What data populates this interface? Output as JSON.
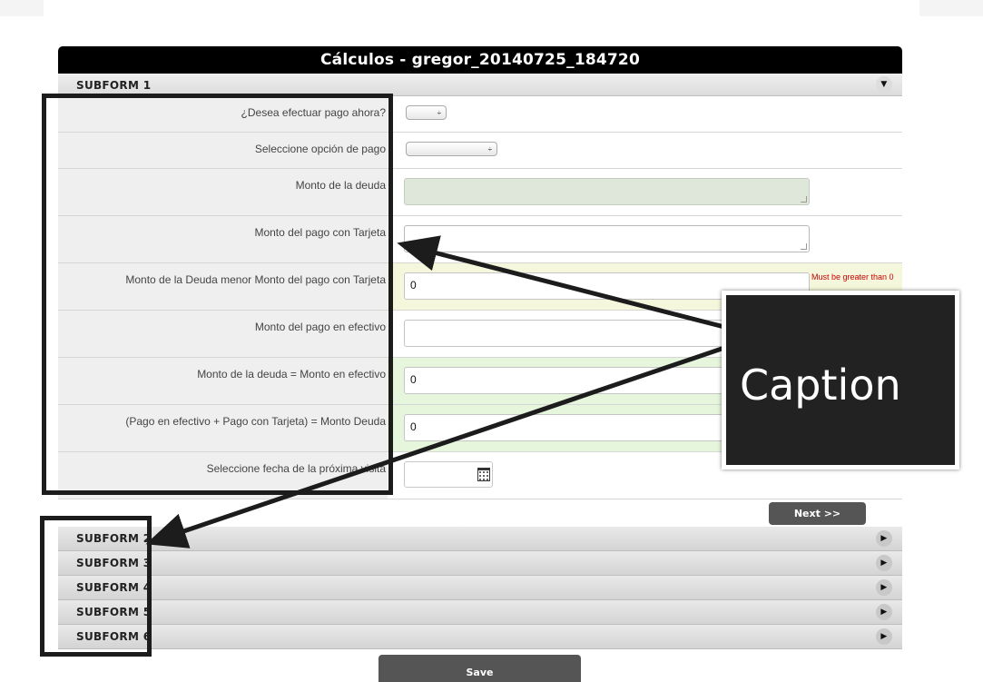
{
  "window": {
    "title": "Cálculos - gregor_20140725_184720"
  },
  "subforms": {
    "active": {
      "label": "SUBFORM 1",
      "toggle_icon": "chevron-down-icon",
      "toggle_glyph": "▼"
    },
    "collapsed": [
      {
        "label": "SUBFORM 2",
        "toggle_icon": "play-icon",
        "toggle_glyph": "▶"
      },
      {
        "label": "SUBFORM 3",
        "toggle_icon": "play-icon",
        "toggle_glyph": "▶"
      },
      {
        "label": "SUBFORM 4",
        "toggle_icon": "play-icon",
        "toggle_glyph": "▶"
      },
      {
        "label": "SUBFORM 5",
        "toggle_icon": "play-icon",
        "toggle_glyph": "▶"
      },
      {
        "label": "SUBFORM 6",
        "toggle_icon": "play-icon",
        "toggle_glyph": "▶"
      }
    ]
  },
  "form": {
    "fields": [
      {
        "label": "¿Desea efectuar pago ahora?",
        "type": "select",
        "value": ""
      },
      {
        "label": "Seleccione opción de pago",
        "type": "select",
        "value": ""
      },
      {
        "label": "Monto de la deuda",
        "type": "textarea",
        "value": "",
        "readonly": true
      },
      {
        "label": "Monto del pago con Tarjeta",
        "type": "textarea",
        "value": ""
      },
      {
        "label": "Monto de la Deuda menor Monto del pago con Tarjeta",
        "type": "text",
        "value": "0",
        "error": "Must be greater than 0"
      },
      {
        "label": "Monto del pago en efectivo",
        "type": "text",
        "value": ""
      },
      {
        "label": "Monto de la deuda = Monto en efectivo",
        "type": "text",
        "value": "0"
      },
      {
        "label": "(Pago en efectivo + Pago con Tarjeta) = Monto Deuda",
        "type": "text",
        "value": "0"
      },
      {
        "label": "Seleccione fecha de la próxima visita",
        "type": "date",
        "value": "",
        "icon": "calendar-icon"
      }
    ],
    "select_arrow": "÷",
    "next_label": "Next >>",
    "save_label": "Save"
  },
  "annotation": {
    "caption": "Caption"
  },
  "colors": {
    "title_bar": "#000000",
    "button": "#555555",
    "error_text": "#cc0000",
    "valid_field": "#e6f6dc",
    "warning_field": "#f5f7dc",
    "caption_box": "#222222"
  }
}
